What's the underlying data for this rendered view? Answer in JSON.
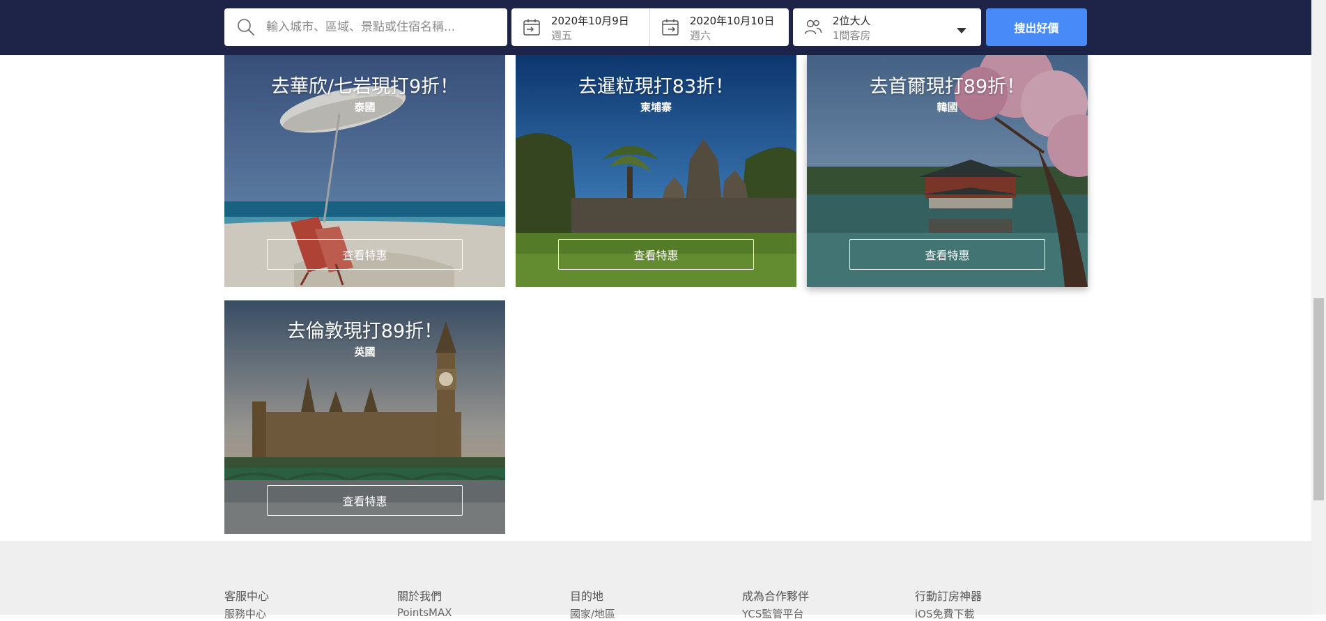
{
  "search": {
    "placeholder": "輸入城市、區域、景點或住宿名稱..."
  },
  "dates": {
    "checkin_date": "2020年10月9日",
    "checkin_day": "週五",
    "checkout_date": "2020年10月10日",
    "checkout_day": "週六"
  },
  "guests": {
    "adults": "2位大人",
    "rooms": "1間客房"
  },
  "search_button": "搜出好價",
  "cards": [
    {
      "title": "去華欣/七岩現打9折！",
      "country": "泰國",
      "button": "查看特惠"
    },
    {
      "title": "去暹粒現打83折！",
      "country": "柬埔寨",
      "button": "查看特惠"
    },
    {
      "title": "去首爾現打89折！",
      "country": "韓國",
      "button": "查看特惠"
    },
    {
      "title": "去倫敦現打89折！",
      "country": "英國",
      "button": "查看特惠"
    }
  ],
  "footer": {
    "columns": [
      {
        "heading": "客服中心",
        "link": "服務中心"
      },
      {
        "heading": "關於我們",
        "link": "PointsMAX"
      },
      {
        "heading": "目的地",
        "link": "國家/地區"
      },
      {
        "heading": "成為合作夥伴",
        "link": "YCS監管平台"
      },
      {
        "heading": "行動訂房神器",
        "link": "iOS免費下載"
      }
    ]
  },
  "colors": {
    "header_bg": "#1d2447",
    "accent": "#488bf8",
    "footer_bg": "#efefef"
  },
  "icons": [
    "search-icon",
    "calendar-checkin-icon",
    "calendar-checkout-icon",
    "people-icon",
    "caret-down-icon"
  ]
}
